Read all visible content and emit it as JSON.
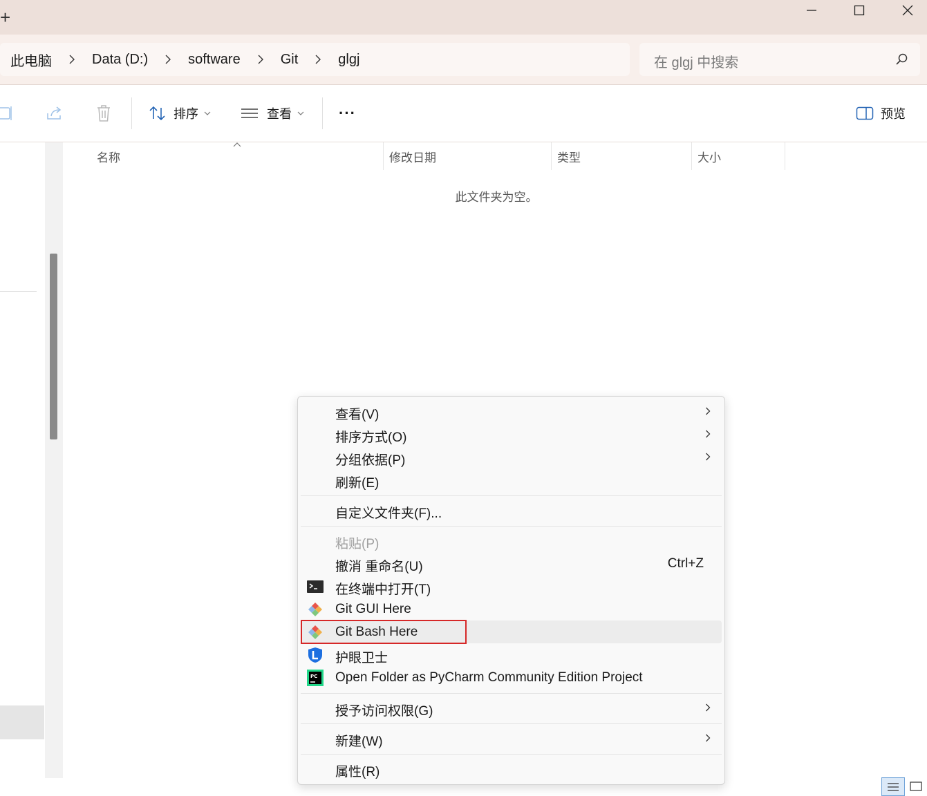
{
  "titlebar": {
    "new_tab_symbol": "+"
  },
  "breadcrumb": [
    "此电脑",
    "Data (D:)",
    "software",
    "Git",
    "glgj"
  ],
  "search": {
    "placeholder": "在 glgj 中搜索"
  },
  "toolbar": {
    "sort_label": "排序",
    "view_label": "查看",
    "more_label": "···",
    "preview_label": "预览"
  },
  "columns": {
    "name": "名称",
    "modified": "修改日期",
    "type": "类型",
    "size": "大小"
  },
  "empty_message": "此文件夹为空。",
  "context_menu": {
    "view": "查看(V)",
    "sort_by": "排序方式(O)",
    "group_by": "分组依据(P)",
    "refresh": "刷新(E)",
    "customize": "自定义文件夹(F)...",
    "paste": "粘贴(P)",
    "undo_rename": "撤消 重命名(U)",
    "undo_shortcut": "Ctrl+Z",
    "open_terminal": "在终端中打开(T)",
    "git_gui": "Git GUI Here",
    "git_bash": "Git Bash Here",
    "eye_guard": "护眼卫士",
    "pycharm": "Open Folder as PyCharm Community Edition Project",
    "grant_access": "授予访问权限(G)",
    "new": "新建(W)",
    "properties": "属性(R)"
  },
  "colors": {
    "titlebar_bg": "#ede0da",
    "address_bg": "#f8efeb",
    "highlight_border": "#d62828",
    "accent": "#0078d4"
  }
}
